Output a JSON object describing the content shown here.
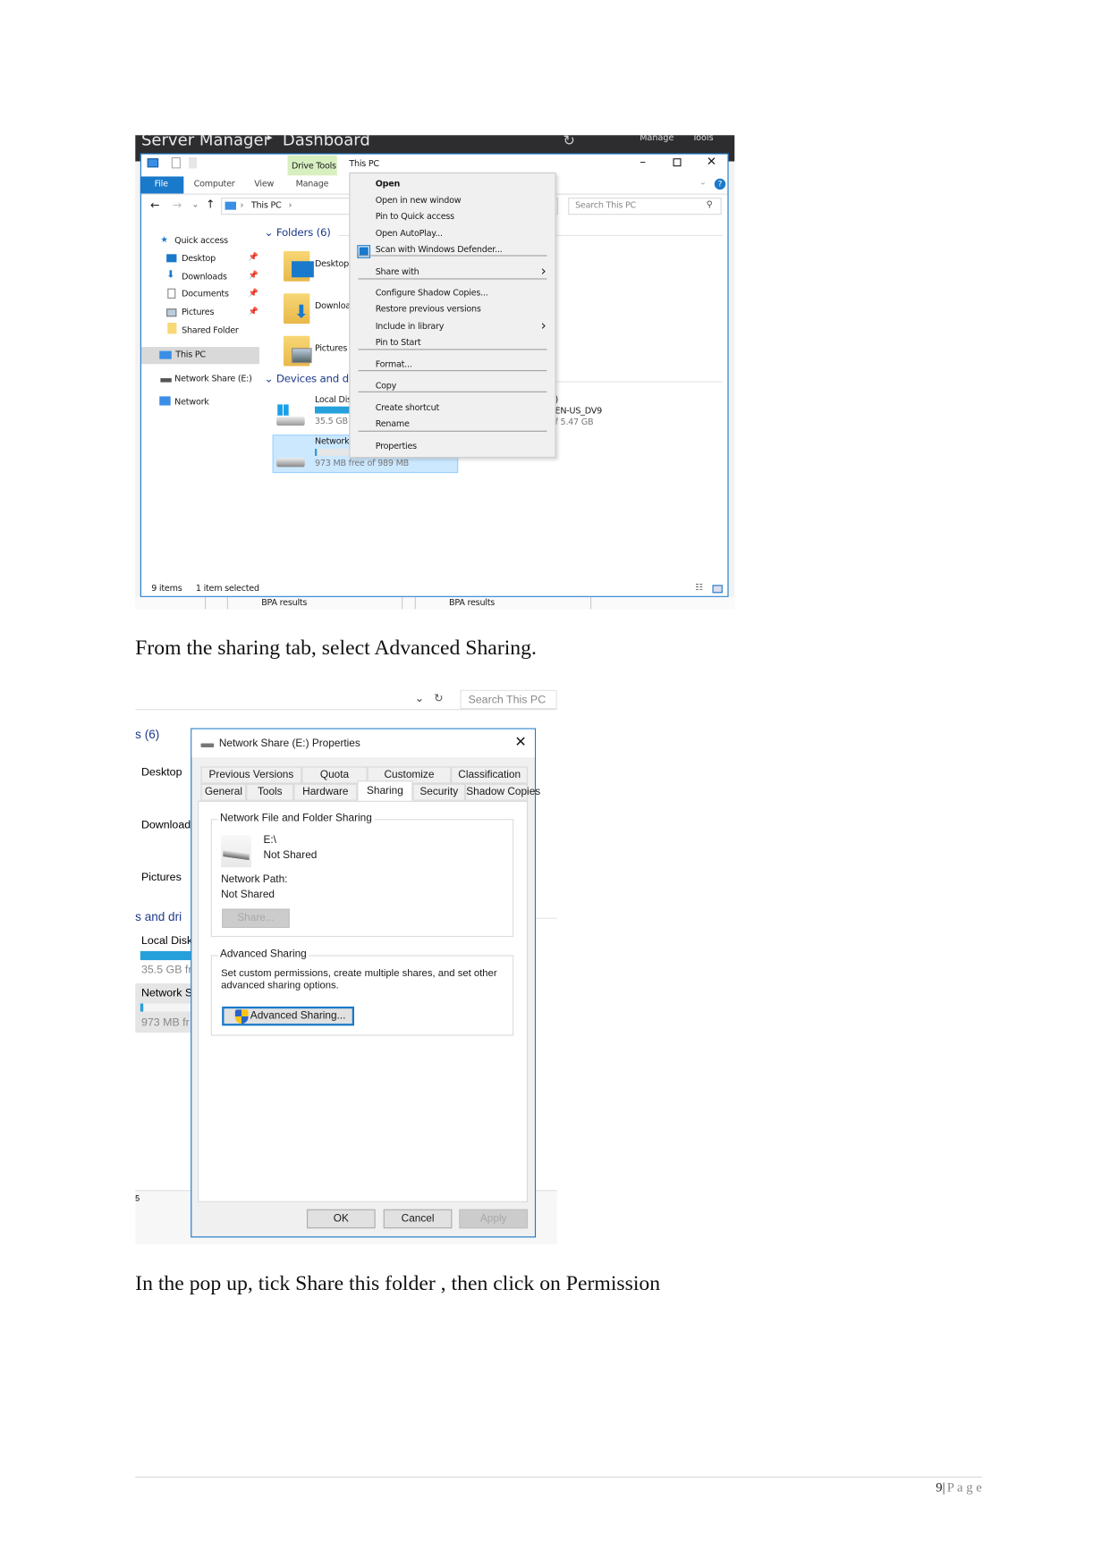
{
  "screenshot1": {
    "server_manager": {
      "title": "Server Manager",
      "breadcrumb_sep": "▸",
      "page": "Dashboard",
      "menu": [
        "Manage",
        "Tools"
      ]
    },
    "explorer": {
      "contextual_tab": "Drive Tools",
      "window_title": "This PC",
      "ribbon_tabs": [
        "File",
        "Computer",
        "View",
        "Manage"
      ],
      "address": "This PC",
      "search_placeholder": "Search This PC",
      "nav": {
        "quick_access": "Quick access",
        "pinned": [
          "Desktop",
          "Downloads",
          "Documents",
          "Pictures"
        ],
        "shared_folder": "Shared Folder",
        "this_pc": "This PC",
        "network_share": "Network Share (E:)",
        "network": "Network"
      },
      "folders_header": "Folders (6)",
      "folders": [
        "Desktop",
        "Downloa",
        "Pictures"
      ],
      "devices_header": "Devices and dr",
      "local_disk": {
        "name": "Local Dis",
        "free": "35.5 GB f",
        "used_fraction": 0.6
      },
      "network_drive": {
        "name": "Network",
        "free": "973 MB free of 989 MB",
        "used_fraction": 0.02
      },
      "dvd": {
        "name_tail": ")",
        "label_tail": "EN-US_DV9",
        "size_tail": "f 5.47 GB"
      },
      "status": {
        "items": "9 items",
        "selected": "1 item selected"
      },
      "context_menu": [
        {
          "label": "Open",
          "bold": true
        },
        {
          "label": "Open in new window"
        },
        {
          "label": "Pin to Quick access"
        },
        {
          "label": "Open AutoPlay..."
        },
        {
          "label": "Scan with Windows Defender...",
          "icon": "windows-defender-icon"
        },
        {
          "label": "Share with",
          "submenu": true
        },
        {
          "label": "Configure Shadow Copies..."
        },
        {
          "label": "Restore previous versions"
        },
        {
          "label": "Include in library",
          "submenu": true
        },
        {
          "label": "Pin to Start"
        },
        {
          "label": "Format..."
        },
        {
          "label": "Copy"
        },
        {
          "label": "Create shortcut"
        },
        {
          "label": "Rename"
        },
        {
          "label": "Properties"
        }
      ]
    },
    "bpa": [
      "BPA results",
      "BPA results"
    ]
  },
  "caption1": "From the sharing tab, select Advanced Sharing.",
  "screenshot2": {
    "background": {
      "search_placeholder": "Search This PC",
      "folders_header": "s (6)",
      "folders": [
        "Desktop",
        "Download",
        "Pictures"
      ],
      "devices_header": "s and dri",
      "local_disk": "Local Disk",
      "local_free": "35.5 GB fr",
      "network": "Network S",
      "network_free": "973 MB fr",
      "footer_fragment": "5"
    },
    "dialog": {
      "title": "Network Share (E:) Properties",
      "tabs_row1": [
        "Previous Versions",
        "Quota",
        "Customize",
        "Classification"
      ],
      "tabs_row2": [
        "General",
        "Tools",
        "Hardware",
        "Sharing",
        "Security",
        "Shadow Copies"
      ],
      "active_tab": "Sharing",
      "group1_title": "Network File and Folder Sharing",
      "drive": "E:\\",
      "drive_status": "Not Shared",
      "network_path_label": "Network Path:",
      "network_path_value": "Not Shared",
      "share_button": "Share...",
      "group2_title": "Advanced Sharing",
      "group2_desc_1": "Set custom permissions, create multiple shares, and set other",
      "group2_desc_2": "advanced sharing options.",
      "advanced_button": "Advanced Sharing...",
      "ok": "OK",
      "cancel": "Cancel",
      "apply": "Apply"
    }
  },
  "caption2": "In the pop up, tick Share this folder , then click on Permission",
  "footer": {
    "page_number": "9",
    "separator": "|",
    "page_label": "P a g e"
  },
  "colors": {
    "accent": "#1979ca",
    "selection": "#cce8ff",
    "drive_bar": "#26a0da",
    "drive_tools": "#d8f0c0"
  }
}
